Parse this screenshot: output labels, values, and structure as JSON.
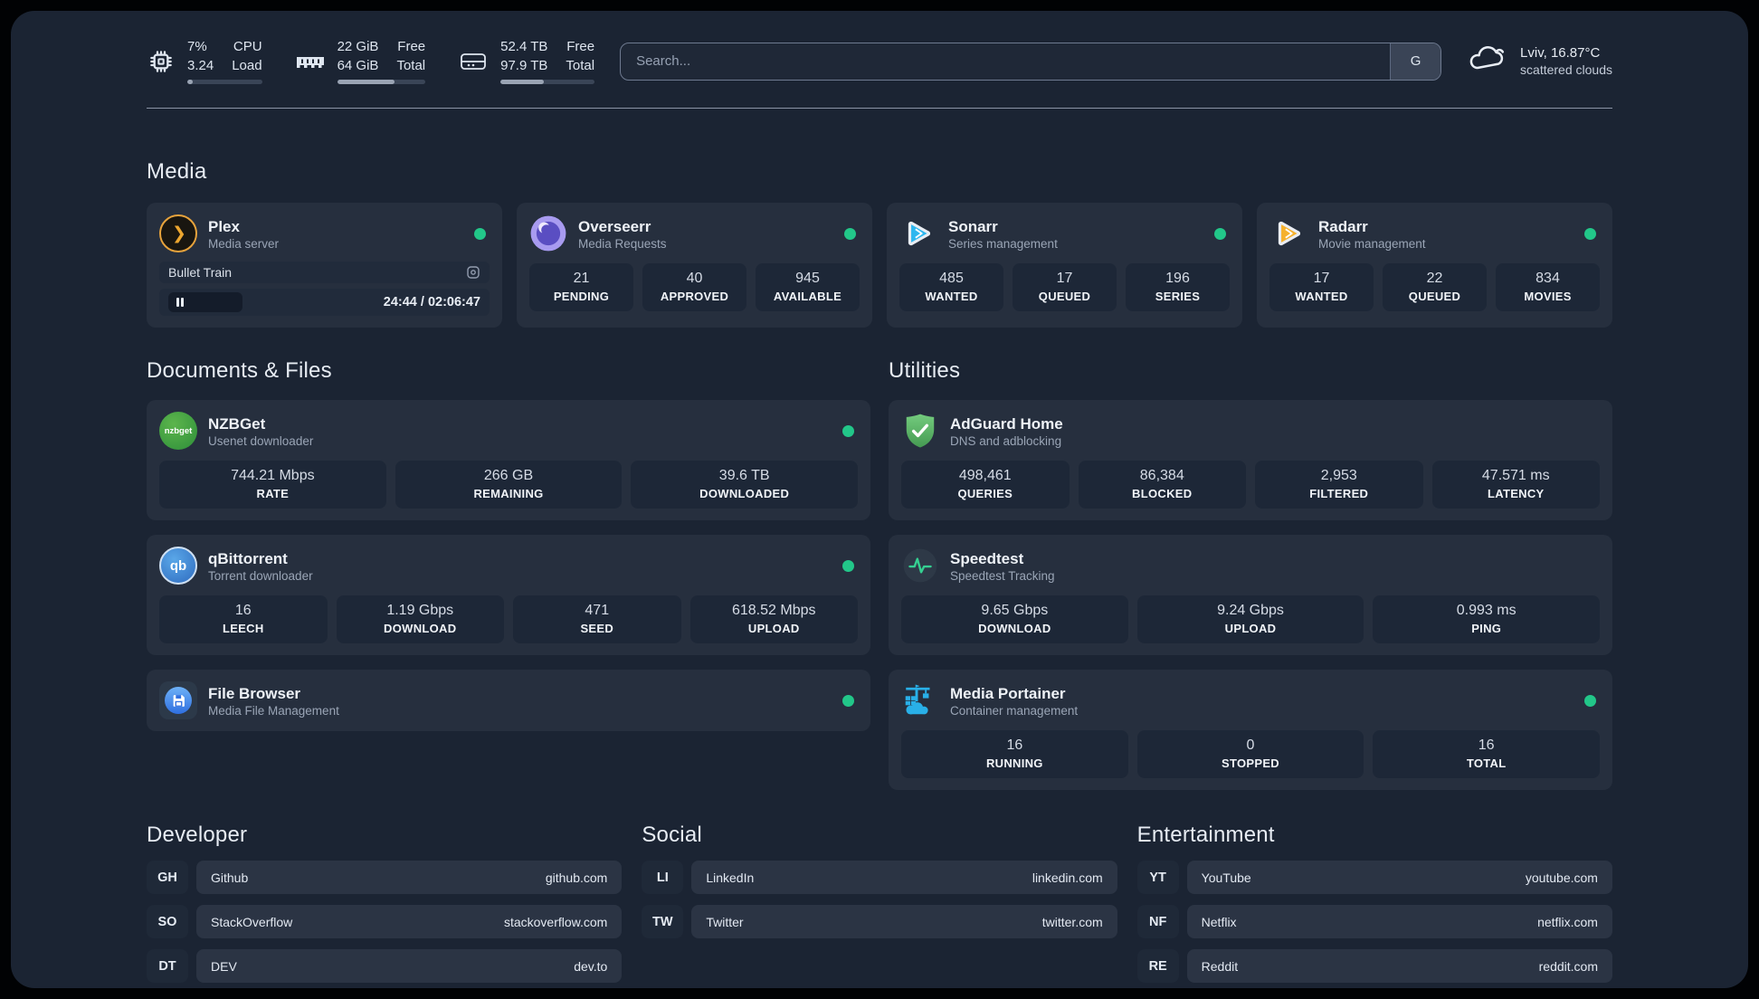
{
  "topbar": {
    "stats": [
      {
        "icon": "cpu-icon",
        "col1": [
          "7%",
          "3.24"
        ],
        "col2": [
          "CPU",
          "Load"
        ],
        "progress_style": "width:7%"
      },
      {
        "icon": "memory-icon",
        "col1": [
          "22 GiB",
          "64 GiB"
        ],
        "col2": [
          "Free",
          "Total"
        ],
        "progress_style": "width:65%"
      },
      {
        "icon": "disk-icon",
        "col1": [
          "52.4 TB",
          "97.9 TB"
        ],
        "col2": [
          "Free",
          "Total"
        ],
        "progress_style": "width:46%"
      }
    ],
    "search": {
      "placeholder": "Search...",
      "engine_button": "G"
    },
    "weather": {
      "title": "Lviv, 16.87°C",
      "subtitle": "scattered clouds"
    }
  },
  "media_section": {
    "title": "Media",
    "plex": {
      "title": "Plex",
      "subtitle": "Media server",
      "status": "online",
      "now_playing": {
        "track": "Bullet Train",
        "time": "24:44 / 02:06:47"
      }
    },
    "overseerr": {
      "title": "Overseerr",
      "subtitle": "Media Requests",
      "status": "online",
      "stats": [
        {
          "value": "21",
          "label": "PENDING"
        },
        {
          "value": "40",
          "label": "APPROVED"
        },
        {
          "value": "945",
          "label": "AVAILABLE"
        }
      ]
    },
    "sonarr": {
      "title": "Sonarr",
      "subtitle": "Series management",
      "status": "online",
      "stats": [
        {
          "value": "485",
          "label": "WANTED"
        },
        {
          "value": "17",
          "label": "QUEUED"
        },
        {
          "value": "196",
          "label": "SERIES"
        }
      ]
    },
    "radarr": {
      "title": "Radarr",
      "subtitle": "Movie management",
      "status": "online",
      "stats": [
        {
          "value": "17",
          "label": "WANTED"
        },
        {
          "value": "22",
          "label": "QUEUED"
        },
        {
          "value": "834",
          "label": "MOVIES"
        }
      ]
    }
  },
  "documents_section": {
    "title": "Documents & Files",
    "nzbget": {
      "title": "NZBGet",
      "subtitle": "Usenet downloader",
      "status": "online",
      "logo_text": "nzbget",
      "stats": [
        {
          "value": "744.21 Mbps",
          "label": "RATE"
        },
        {
          "value": "266 GB",
          "label": "REMAINING"
        },
        {
          "value": "39.6 TB",
          "label": "DOWNLOADED"
        }
      ]
    },
    "qbittorrent": {
      "title": "qBittorrent",
      "subtitle": "Torrent downloader",
      "status": "online",
      "logo_text": "qb",
      "stats": [
        {
          "value": "16",
          "label": "LEECH"
        },
        {
          "value": "1.19 Gbps",
          "label": "DOWNLOAD"
        },
        {
          "value": "471",
          "label": "SEED"
        },
        {
          "value": "618.52 Mbps",
          "label": "UPLOAD"
        }
      ]
    },
    "filebrowser": {
      "title": "File Browser",
      "subtitle": "Media File Management",
      "status": "online"
    }
  },
  "utilities_section": {
    "title": "Utilities",
    "adguard": {
      "title": "AdGuard Home",
      "subtitle": "DNS and adblocking",
      "stats": [
        {
          "value": "498,461",
          "label": "QUERIES"
        },
        {
          "value": "86,384",
          "label": "BLOCKED"
        },
        {
          "value": "2,953",
          "label": "FILTERED"
        },
        {
          "value": "47.571 ms",
          "label": "LATENCY"
        }
      ]
    },
    "speedtest": {
      "title": "Speedtest",
      "subtitle": "Speedtest Tracking",
      "stats": [
        {
          "value": "9.65 Gbps",
          "label": "DOWNLOAD"
        },
        {
          "value": "9.24 Gbps",
          "label": "UPLOAD"
        },
        {
          "value": "0.993 ms",
          "label": "PING"
        }
      ]
    },
    "portainer": {
      "title": "Media Portainer",
      "subtitle": "Container management",
      "status": "online",
      "stats": [
        {
          "value": "16",
          "label": "RUNNING"
        },
        {
          "value": "0",
          "label": "STOPPED"
        },
        {
          "value": "16",
          "label": "TOTAL"
        }
      ]
    }
  },
  "link_sections": [
    {
      "title": "Developer",
      "links": [
        {
          "abbr": "GH",
          "name": "Github",
          "url": "github.com"
        },
        {
          "abbr": "SO",
          "name": "StackOverflow",
          "url": "stackoverflow.com"
        },
        {
          "abbr": "DT",
          "name": "DEV",
          "url": "dev.to"
        }
      ]
    },
    {
      "title": "Social",
      "links": [
        {
          "abbr": "LI",
          "name": "LinkedIn",
          "url": "linkedin.com"
        },
        {
          "abbr": "TW",
          "name": "Twitter",
          "url": "twitter.com"
        }
      ]
    },
    {
      "title": "Entertainment",
      "links": [
        {
          "abbr": "YT",
          "name": "YouTube",
          "url": "youtube.com"
        },
        {
          "abbr": "NF",
          "name": "Netflix",
          "url": "netflix.com"
        },
        {
          "abbr": "RE",
          "name": "Reddit",
          "url": "reddit.com"
        }
      ]
    }
  ],
  "colors": {
    "status_online": "#22c789",
    "plex_orange": "#e7a33c",
    "sonarr_blue": "#2eb7ef",
    "radarr_yellow": "#f5b12d",
    "adguard_green": "#5fb86a",
    "portainer_blue": "#29b0e8",
    "speedtest_pulse": "#35d091",
    "page_background": "#1b2433",
    "card_background": "#262f3e",
    "tile_background": "#1d2737"
  }
}
